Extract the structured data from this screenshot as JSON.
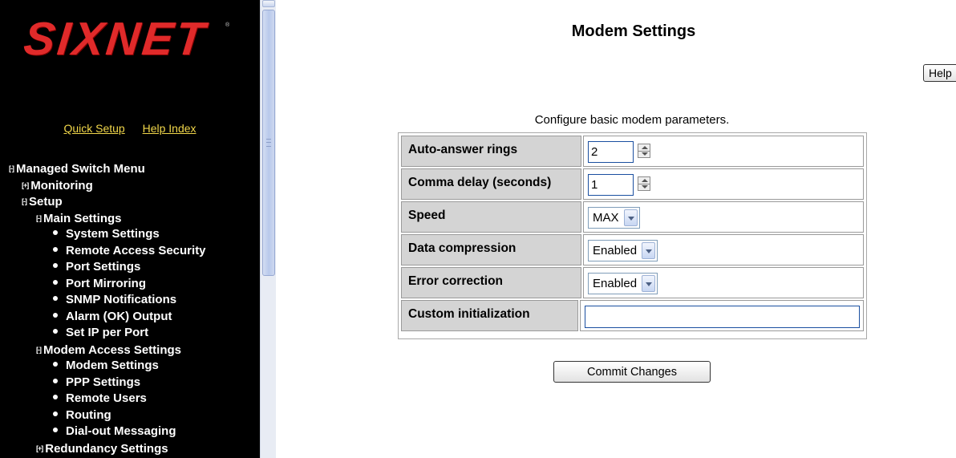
{
  "sidebar": {
    "logo_text": "SIXNET",
    "logo_registered": "®",
    "logo_color": "#e02a2a",
    "quick_links": [
      "Quick Setup",
      "Help Index"
    ],
    "link_color": "#f0d64a",
    "menu": {
      "root": {
        "toggle": "[-]",
        "label": "Managed Switch Menu"
      },
      "monitoring": {
        "toggle": "[+]",
        "label": "Monitoring"
      },
      "setup": {
        "toggle": "[-]",
        "label": "Setup"
      },
      "main_settings": {
        "toggle": "[-]",
        "label": "Main Settings"
      },
      "main_settings_items": [
        "System Settings",
        "Remote Access Security",
        "Port Settings",
        "Port Mirroring",
        "SNMP Notifications",
        "Alarm (OK) Output",
        "Set IP per Port"
      ],
      "modem_access": {
        "toggle": "[-]",
        "label": "Modem Access Settings"
      },
      "modem_access_items": [
        "Modem Settings",
        "PPP Settings",
        "Remote Users",
        "Routing",
        "Dial-out Messaging"
      ],
      "redundancy": {
        "toggle": "[+]",
        "label": "Redundancy Settings"
      }
    }
  },
  "main": {
    "title": "Modem Settings",
    "help_label": "Help",
    "description": "Configure basic modem parameters.",
    "fields": {
      "auto_answer": {
        "label": "Auto-answer rings",
        "value": "2"
      },
      "comma_delay": {
        "label": "Comma delay (seconds)",
        "value": "1"
      },
      "speed": {
        "label": "Speed",
        "value": "MAX"
      },
      "data_compression": {
        "label": "Data compression",
        "value": "Enabled"
      },
      "error_correction": {
        "label": "Error correction",
        "value": "Enabled"
      },
      "custom_init": {
        "label": "Custom initialization",
        "value": ""
      }
    },
    "commit_label": "Commit Changes"
  }
}
